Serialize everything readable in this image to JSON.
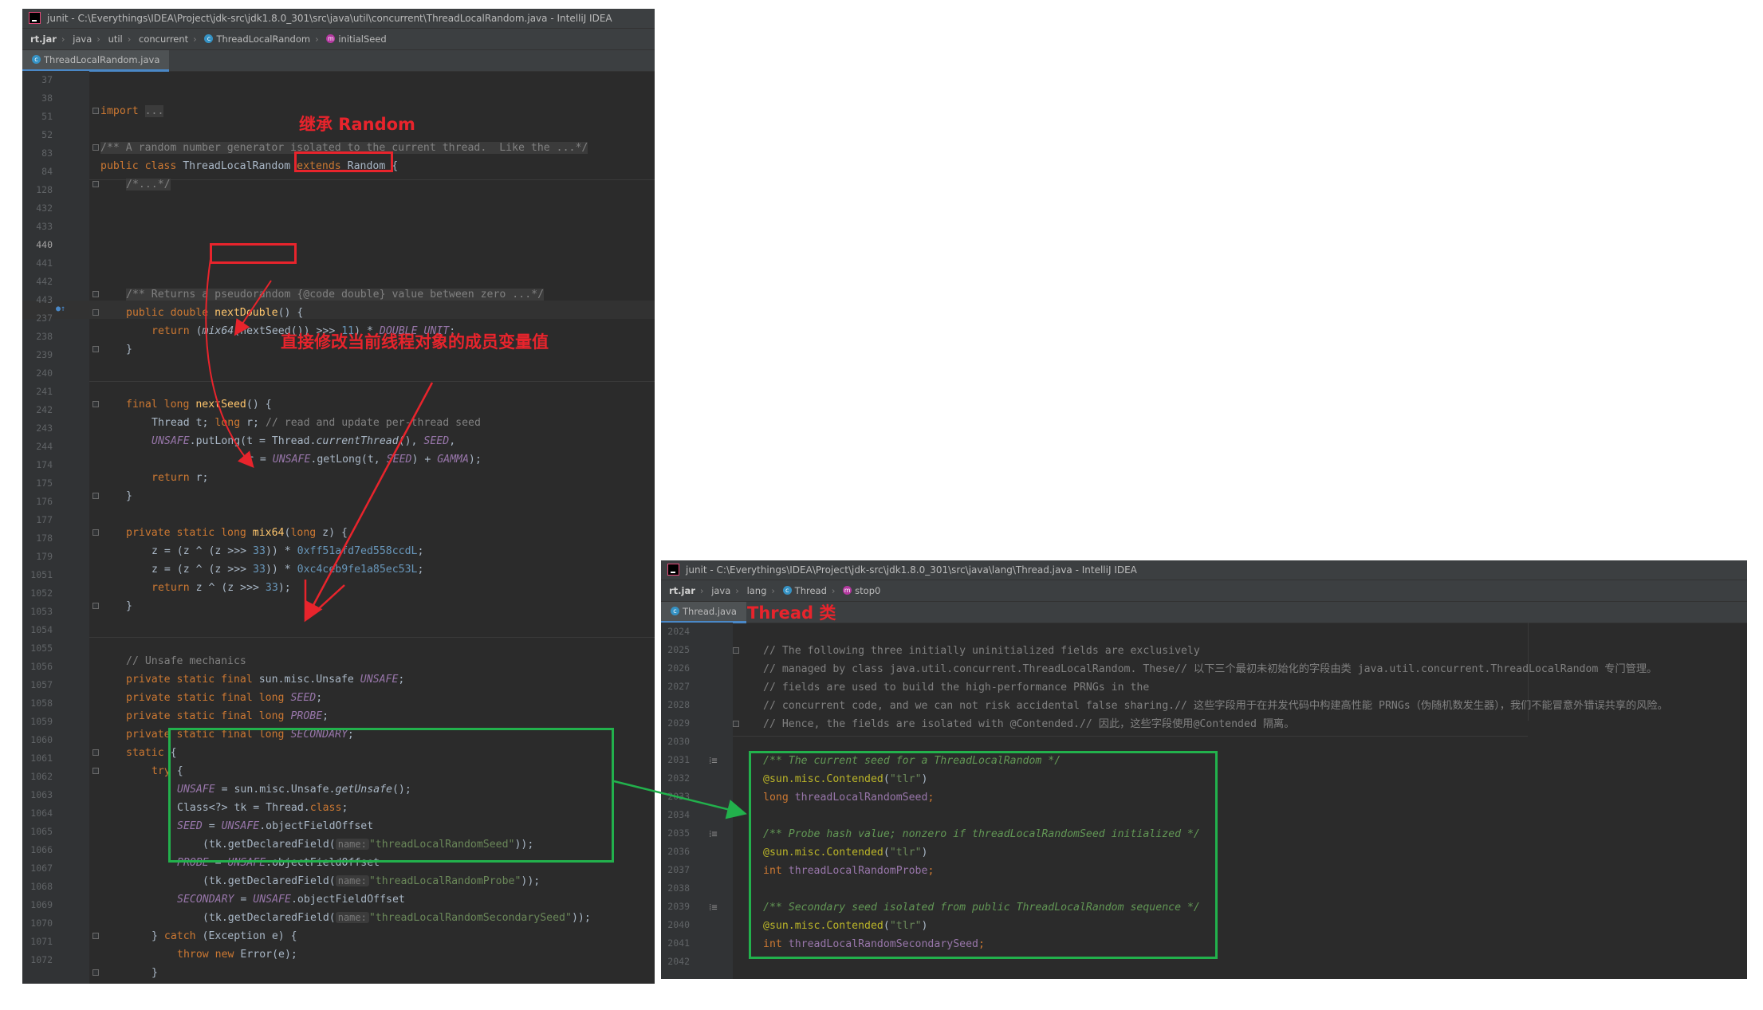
{
  "win1": {
    "title": "junit - C:\\Everythings\\IDEA\\Project\\jdk-src\\jdk1.8.0_301\\src\\java\\util\\concurrent\\ThreadLocalRandom.java - IntelliJ IDEA",
    "breadcrumbs": [
      "rt.jar",
      "java",
      "util",
      "concurrent",
      "ThreadLocalRandom",
      "initialSeed"
    ],
    "tab": "ThreadLocalRandom.java"
  },
  "win2": {
    "title": "junit - C:\\Everythings\\IDEA\\Project\\jdk-src\\jdk1.8.0_301\\src\\java\\lang\\Thread.java - IntelliJ IDEA",
    "breadcrumbs": [
      "rt.jar",
      "java",
      "lang",
      "Thread",
      "stop0"
    ],
    "tab": "Thread.java"
  },
  "annotations": {
    "extends_label": "继承 Random",
    "modify_label": "直接修改当前线程对象的成员变量值",
    "thread_label": "Thread 类"
  },
  "code1": {
    "ln": [
      "37",
      "38",
      "51",
      "52",
      "83",
      "84",
      "128",
      "432",
      "433",
      "440",
      "441",
      "442",
      "443",
      "237",
      "238",
      "239",
      "240",
      "241",
      "242",
      "243",
      "244",
      "174",
      "175",
      "176",
      "177",
      "178",
      "179",
      "1051",
      "1052",
      "1053",
      "1054",
      "1055",
      "1056",
      "1057",
      "1058",
      "1059",
      "1060",
      "1061",
      "1062",
      "1063",
      "1064",
      "1065",
      "1066",
      "1067",
      "1068",
      "1069",
      "1070",
      "1071",
      "1072"
    ],
    "l1_import": "import",
    "l1_import_fold": "...",
    "l3_doc": "/** A random number generator isolated to the current thread.  Like the ...*/",
    "l4_public": "public class",
    "l4_name": " ThreadLocalRandom ",
    "l4_extends": "extends",
    "l4_random": " Random",
    "l4_brace": " {",
    "l5_fold": "/*...*/",
    "l8_doc": "/** Returns a pseudorandom {@code double} value between zero ...*/",
    "l9_kw": "public double ",
    "l9_fn": "nextDouble",
    "l9_rest": "() {",
    "l10_return": "return ",
    "l10_a": "(",
    "l10_mix": "mix64",
    "l10_b": "(nextSeed()) >>> ",
    "l10_11": "11",
    "l10_c": ") * ",
    "l10_unit": "DOUBLE_UNIT",
    "l10_d": ";",
    "l11": "}",
    "l14_kw": "final long ",
    "l14_fn": "nextSeed",
    "l14_rest": "() {",
    "l15_a": "Thread t; ",
    "l15_long": "long",
    "l15_b": " r; ",
    "l15_com": "// read and update per-thread seed",
    "l16_unsafe": "UNSAFE",
    "l16_a": ".putLong(t = Thread.",
    "l16_ct": "currentThread",
    "l16_b": "(), ",
    "l16_seed": "SEED",
    "l16_c": ",",
    "l17_a": "r = ",
    "l17_unsafe": "UNSAFE",
    "l17_b": ".getLong(t, ",
    "l17_seed": "SEED",
    "l17_c": ") + ",
    "l17_gamma": "GAMMA",
    "l17_d": ");",
    "l18_return": "return",
    "l18_rest": " r;",
    "l19": "}",
    "l21_kw": "private static long ",
    "l21_fn": "mix64",
    "l21_a": "(",
    "l21_long": "long",
    "l21_b": " z) {",
    "l22_a": "z = (z ^ (z >>> ",
    "l22_33": "33",
    "l22_b": ")) * ",
    "l22_hex": "0xff51afd7ed558ccdL",
    "l22_c": ";",
    "l23_a": "z = (z ^ (z >>> ",
    "l23_33": "33",
    "l23_b": ")) * ",
    "l23_hex": "0xc4ceb9fe1a85ec53L",
    "l23_c": ";",
    "l24_return": "return",
    "l24_a": " z ^ (z >>> ",
    "l24_33": "33",
    "l24_b": ");",
    "l25": "}",
    "l28_com": "// Unsafe mechanics",
    "l29_kw": "private static final ",
    "l29_a": "sun.misc.Unsafe ",
    "l29_f": "UNSAFE",
    "l29_b": ";",
    "l30_kw": "private static final long ",
    "l30_f": "SEED",
    "l30_b": ";",
    "l31_kw": "private static final long ",
    "l31_f": "PROBE",
    "l31_b": ";",
    "l32_kw": "private static final long ",
    "l32_f": "SECONDARY",
    "l32_b": ";",
    "l33_kw": "static",
    "l33_b": " {",
    "l34_kw": "try",
    "l34_b": " {",
    "l35_f": "UNSAFE",
    "l35_a": " = sun.misc.Unsafe.",
    "l35_m": "getUnsafe",
    "l35_b": "();",
    "l36_a": "Class<?> tk = Thread.",
    "l36_kw": "class",
    "l36_b": ";",
    "l37_f": "SEED",
    "l37_a": " = ",
    "l37_u": "UNSAFE",
    "l37_b": ".objectFieldOffset",
    "l38_a": "(tk.getDeclaredField(",
    "l38_hint": "name:",
    "l38_str": "\"threadLocalRandomSeed\"",
    "l38_b": "));",
    "l39_f": "PROBE",
    "l39_a": " = ",
    "l39_u": "UNSAFE",
    "l39_b": ".objectFieldOffset",
    "l40_a": "(tk.getDeclaredField(",
    "l40_hint": "name:",
    "l40_str": "\"threadLocalRandomProbe\"",
    "l40_b": "));",
    "l41_f": "SECONDARY",
    "l41_a": " = ",
    "l41_u": "UNSAFE",
    "l41_b": ".objectFieldOffset",
    "l42_a": "(tk.getDeclaredField(",
    "l42_hint": "name:",
    "l42_str": "\"threadLocalRandomSecondarySeed\"",
    "l42_b": "));",
    "l43_a": "} ",
    "l43_kw": "catch",
    "l43_b": " (Exception e) {",
    "l44_kw": "throw new",
    "l44_b": " Error(e);",
    "l45": "}",
    "l46": "}",
    "l47": "}"
  },
  "code2": {
    "ln": [
      "2024",
      "2025",
      "2026",
      "2027",
      "2028",
      "2029",
      "2030",
      "2031",
      "2032",
      "2033",
      "2034",
      "2035",
      "2036",
      "2037",
      "2038",
      "2039",
      "2040",
      "2041",
      "2042"
    ],
    "c1": "// The following three initially uninitialized fields are exclusively",
    "c2": "// managed by class java.util.concurrent.ThreadLocalRandom. These// 以下三个最初未初始化的字段由类 java.util.concurrent.ThreadLocalRandom 专门管理。",
    "c3": "// fields are used to build the high-performance PRNGs in the",
    "c4": "// concurrent code, and we can not risk accidental false sharing.// 这些字段用于在并发代码中构建高性能 PRNGs（伪随机数发生器），我们不能冒意外错误共享的风险。",
    "c5": "// Hence, the fields are isolated with @Contended.// 因此，这些字段使用@Contended 隔离。",
    "d1": "/** The current seed for a ThreadLocalRandom */",
    "a1_ann": "@sun.misc.",
    "a1_name": "Contended",
    "a1_open": "(",
    "a1_str": "\"tlr\"",
    "a1_close": ")",
    "f1_kw": "long ",
    "f1_name": "threadLocalRandomSeed",
    "f1_end": ";",
    "d2": "/** Probe hash value; nonzero if threadLocalRandomSeed initialized */",
    "a2_ann": "@sun.misc.",
    "a2_name": "Contended",
    "a2_open": "(",
    "a2_str": "\"tlr\"",
    "a2_close": ")",
    "f2_kw": "int ",
    "f2_name": "threadLocalRandomProbe",
    "f2_end": ";",
    "d3": "/** Secondary seed isolated from public ThreadLocalRandom sequence */",
    "a3_ann": "@sun.misc.",
    "a3_name": "Contended",
    "a3_open": "(",
    "a3_str": "\"tlr\"",
    "a3_close": ")",
    "f3_kw": "int ",
    "f3_name": "threadLocalRandomSecondarySeed",
    "f3_end": ";"
  },
  "colors": {
    "editor_bg": "#2b2b2b",
    "gutter_bg": "#313335",
    "keyword": "#cc7832",
    "method": "#ffc66d",
    "number": "#6897bb",
    "string": "#6a8759",
    "comment": "#808080",
    "doc_comment": "#629755",
    "static_field": "#9876aa",
    "annotation": "#bbb529",
    "red_markup": "#e8242c",
    "green_markup": "#22b14c"
  }
}
